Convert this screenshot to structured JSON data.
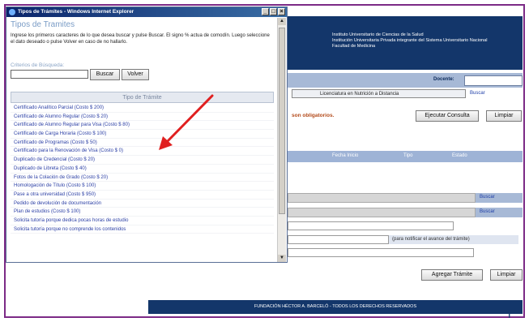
{
  "background": {
    "institution_lines": [
      "Instituto Universitario de Ciencias de la Salud",
      "Institución Universitaria Privada integrante del Sistema Universitario Nacional",
      "Facultad de Medicina"
    ],
    "docente_label": "Docente:",
    "carrera_value": "Licenciatura en Nutrición a Distancia",
    "buscar_link": "Buscar",
    "obligatorios_text": "son obligatorios.",
    "ejecutar_button": "Ejecutar Consulta",
    "limpiar_button": "Limpiar",
    "table_headers": [
      "Fecha Inicio",
      "Tipo",
      "Estado"
    ],
    "buscar_link_2": "Buscar",
    "buscar_link_3": "Buscar",
    "notificar_text": "(para notificar el avance del trámite)",
    "agregar_button": "Agregar Trámite",
    "limpiar_button_2": "Limpiar",
    "footer_text": "FUNDACIÓN HÉCTOR A. BARCELÓ - TODOS LOS DERECHOS RESERVADOS",
    "footer_corner": "T"
  },
  "popup": {
    "window_title": "Tipos de Trámites - Windows Internet Explorer",
    "heading": "Tipos de Tramites",
    "instructions": "Ingrese los primeros caracteres de lo que desea buscar y pulse Buscar. El signo % actua de comodín. Luego seleccione el dato deseado o pulse Volver en caso de no hallarlo.",
    "criterios_label": "Criterios de Búsqueda:",
    "buscar_button": "Buscar",
    "volver_button": "Volver",
    "list_header": "Tipo de Trámite",
    "tramites": [
      "Certificado Analítico Parcial (Costo $ 200)",
      "Certificado de Alumno Regular (Costo $ 20)",
      "Certificado de Alumno Regular para Visa (Costo $ 80)",
      "Certificado de Carga Horaria (Costo $ 100)",
      "Certificado de Programas (Costo $ 50)",
      "Certificado para la Renovación de Visa (Costo $ 0)",
      "Duplicado de Credencial (Costo $ 20)",
      "Duplicado de Libreta (Costo $ 40)",
      "Fotos de la Colación de Grado (Costo $ 20)",
      "Homologación de Título (Costo $ 100)",
      "Pase a otra universidad (Costo $ 950)",
      "Pedido de devolución de documentación",
      "Plan de estudios (Costo $ 100)",
      "Solicita tutoría porque dedica pocas horas de estudio",
      "Solicita tutoría porque no comprende los contenidos"
    ]
  },
  "colors": {
    "frame": "#7c2a86",
    "header_navy": "#13366a",
    "accent_blue": "#a7b9d6",
    "link_blue": "#2b3fa5",
    "arrow_red": "#e02020"
  }
}
